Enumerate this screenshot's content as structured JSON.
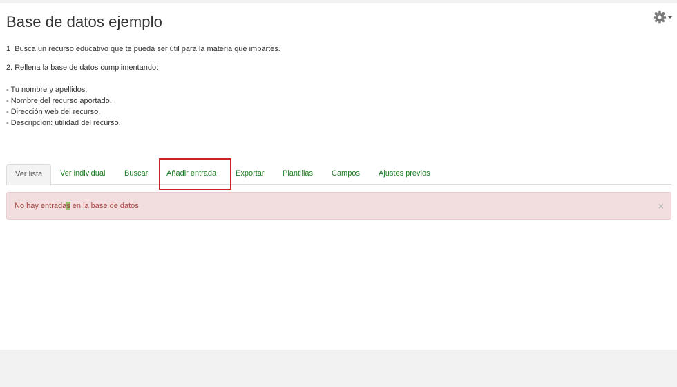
{
  "page": {
    "title": "Base de datos ejemplo"
  },
  "intro": {
    "line1": "1  Busca un recurso educativo que te pueda ser útil para la materia que impartes.",
    "line2": "2. Rellena la base de datos cumplimentando:",
    "items": [
      "- Tu nombre y apellidos.",
      "- Nombre del recurso aportado.",
      "- Dirección web del recurso.",
      "- Descripción: utilidad del recurso."
    ]
  },
  "tabs": [
    {
      "label": "Ver lista",
      "active": true
    },
    {
      "label": "Ver individual",
      "active": false
    },
    {
      "label": "Buscar",
      "active": false
    },
    {
      "label": "Añadir entrada",
      "active": false
    },
    {
      "label": "Exportar",
      "active": false
    },
    {
      "label": "Plantillas",
      "active": false
    },
    {
      "label": "Campos",
      "active": false
    },
    {
      "label": "Ajustes previos",
      "active": false
    }
  ],
  "alert": {
    "text_before": "No hay entrada",
    "text_marked": "s",
    "text_after": " en la base de datos",
    "close": "×"
  },
  "icons": {
    "settings": "gear-icon",
    "settings_caret": "caret-down-icon"
  },
  "colors": {
    "link": "#1b7c23",
    "alert_bg": "#f2dede",
    "alert_text": "#a94442",
    "highlight": "#cc2222"
  }
}
